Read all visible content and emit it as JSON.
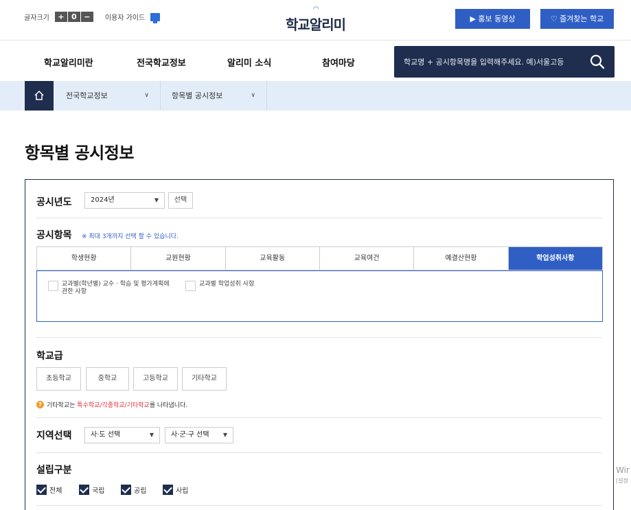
{
  "topbar": {
    "font_size_label": "글자크기",
    "font_buttons": [
      "+",
      "0",
      "−"
    ],
    "guide_label": "이용자 가이드",
    "logo_text": "학교알리미",
    "promo_button": "▶  홍보 동영상",
    "fav_button": "즐겨찾는 학교"
  },
  "nav": {
    "items": [
      "학교알리미란",
      "전국학교정보",
      "알리미 소식",
      "참여마당"
    ],
    "search_placeholder": "학교명 + 공시항목명을 입력해주세요. 예)서울고등"
  },
  "breadcrumb": {
    "items": [
      "전국학교정보",
      "항목별 공시정보"
    ]
  },
  "page_title": "항목별 공시정보",
  "form": {
    "year_label": "공시년도",
    "year_value": "2024년",
    "select_button": "선택",
    "item_label": "공시항목",
    "item_note": "※ 최대 3개까지 선택 할 수 있습니다.",
    "tabs": [
      "학생현황",
      "교원현황",
      "교육활동",
      "교육여건",
      "예결산현황",
      "학업성취사항"
    ],
    "active_tab": "학업성취사항",
    "options": [
      "교과별(학년별) 교수 · 학습 및 평가계획에 관한 사항",
      "교과별 학업성취 사항"
    ],
    "level_label": "학교급",
    "levels": [
      "초등학교",
      "중학교",
      "고등학교",
      "기타학교"
    ],
    "hint_prefix": "기타학교는",
    "hint_red": "특수학교/각종학교/기타학교",
    "hint_suffix": "를 나타냅니다.",
    "region_label": "지역선택",
    "region_sido": "사·도 선택",
    "region_sigungu": "사·군·구 선택",
    "founding_label": "설립구분",
    "founding": [
      "전체",
      "국립",
      "공립",
      "사립"
    ]
  },
  "watermark": {
    "line1": "Wir",
    "line2": "[설정"
  }
}
